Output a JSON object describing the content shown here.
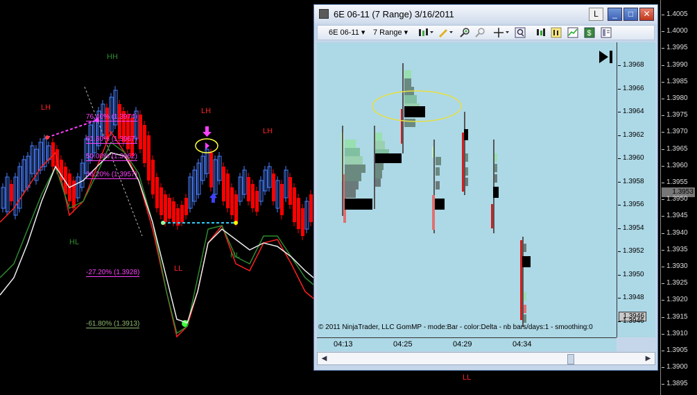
{
  "window": {
    "title": "6E 06-11 (7 Range)  3/16/2011",
    "buttons": {
      "layout": "L",
      "minimize": "_",
      "maximize": "□",
      "close": "✕"
    }
  },
  "toolbar": {
    "instrument": "6E 06-11",
    "interval": "7 Range",
    "icons": [
      "bar-type-icon",
      "pencil-draw-icon",
      "zoom-in-icon",
      "zoom-out-icon",
      "crosshair-icon",
      "magnifier-icon",
      "strategy-icon",
      "indicator-icon",
      "chart-properties-icon",
      "dollar-icon",
      "data-box-icon"
    ]
  },
  "inner_chart": {
    "copyright": "© 2011 NinjaTrader, LLC    GomMP - mode:Bar  - color:Delta - nb bars/days:1 - smoothing:0",
    "price_ticks": [
      "1.3968",
      "1.3966",
      "1.3964",
      "1.3962",
      "1.3960",
      "1.3958",
      "1.3956",
      "1.3954",
      "1.3952",
      "1.3950",
      "1.3948",
      "1.3946"
    ],
    "current_price": "1.3946",
    "time_ticks": [
      "04:13",
      "04:25",
      "04:29",
      "04:34"
    ],
    "play_icon": "go-to-end-icon"
  },
  "outer_chart": {
    "price_ticks": [
      "1.4005",
      "1.4000",
      "1.3995",
      "1.3990",
      "1.3985",
      "1.3980",
      "1.3975",
      "1.3970",
      "1.3965",
      "1.3960",
      "1.3955",
      "1.3950",
      "1.3945",
      "1.3940",
      "1.3935",
      "1.3930",
      "1.3925",
      "1.3920",
      "1.3915",
      "1.3910",
      "1.3905",
      "1.3900",
      "1.3895"
    ],
    "current_price": "1.3953",
    "swing_labels": {
      "hh": "HH",
      "lh1": "LH",
      "lh2": "LH",
      "lh3": "LH",
      "hl1": "HL",
      "hl2": "HL",
      "ll1": "LL",
      "ll2": "LL"
    },
    "fib_levels": {
      "f76": "76.40% (1.3974)",
      "f61": "61.80% (1.3967)",
      "f50": "50.00% (1.3962)",
      "f38": "38.20% (1.3957)",
      "fm27": "-27.20% (1.3928)",
      "fm61": "-61.80% (1.3913)"
    }
  },
  "colors": {
    "up_candle": "#4a7fff",
    "down_candle": "#ff0000",
    "swing_red": "#ff2020",
    "swing_green": "#2e8b2e",
    "fib": "#ff40ff",
    "window_plot_bg": "#add8e6"
  }
}
